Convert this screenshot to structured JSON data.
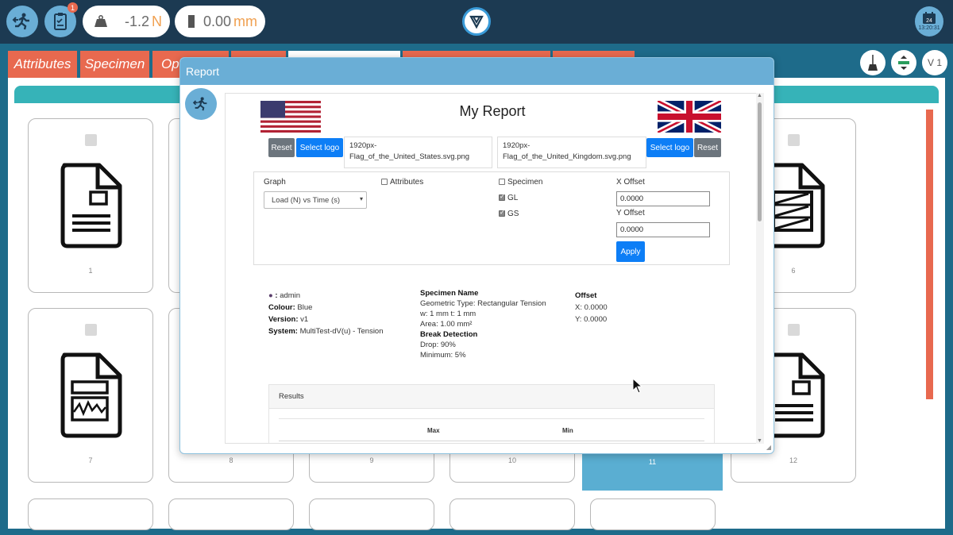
{
  "topbar": {
    "notification_count": "1",
    "load": {
      "value": "-1.2",
      "unit": "N"
    },
    "position": {
      "value": "0.00",
      "unit": "mm"
    },
    "clock": {
      "day": "24",
      "time": "13:20:31"
    }
  },
  "tabs": [
    "Attributes",
    "Specimen",
    "Ope",
    "",
    "",
    "",
    ""
  ],
  "tools": {
    "version": "V 1"
  },
  "cards": [
    {
      "num": "1"
    },
    {
      "num": "6"
    },
    {
      "num": "7"
    },
    {
      "num": "8"
    },
    {
      "num": "9"
    },
    {
      "num": "10"
    },
    {
      "num": "11"
    },
    {
      "num": "12"
    }
  ],
  "modal": {
    "title": "Report",
    "report_title": "My Report",
    "left_logo": {
      "reset": "Reset",
      "select": "Select logo",
      "filename": "1920px-Flag_of_the_United_States.svg.png",
      "filename_line1": "1920px-",
      "filename_line2": "Flag_of_the_United_States.svg.png"
    },
    "right_logo": {
      "reset": "Reset",
      "select": "Select logo",
      "filename_line1": "1920px-",
      "filename_line2": "Flag_of_the_United_Kingdom.svg.png"
    },
    "form": {
      "graph_label": "Graph",
      "graph_value": "Load (N) vs Time (s)",
      "attributes_label": "Attributes",
      "specimen_label": "Specimen",
      "gl_label": "GL",
      "gs_label": "GS",
      "x_offset_label": "X Offset",
      "x_offset_value": "0.0000",
      "y_offset_label": "Y Offset",
      "y_offset_value": "0.0000",
      "apply": "Apply"
    },
    "info_left": {
      "user_sep": ":",
      "user": "admin",
      "colour_label": "Colour:",
      "colour": "Blue",
      "version_label": "Version:",
      "version": "v1",
      "system_label": "System:",
      "system": "MultiTest-dV(u) - Tension"
    },
    "info_mid": {
      "specimen_heading": "Specimen Name",
      "geometric": "Geometric Type: Rectangular Tension",
      "dims": "w: 1 mm t: 1 mm",
      "area": "Area: 1.00 mm²",
      "break_heading": "Break Detection",
      "drop": "Drop: 90%",
      "minimum": "Minimum: 5%"
    },
    "info_right": {
      "offset_heading": "Offset",
      "x": "X: 0.0000",
      "y": "Y: 0.0000"
    },
    "results": {
      "title": "Results",
      "col_max": "Max",
      "col_min": "Min"
    }
  }
}
